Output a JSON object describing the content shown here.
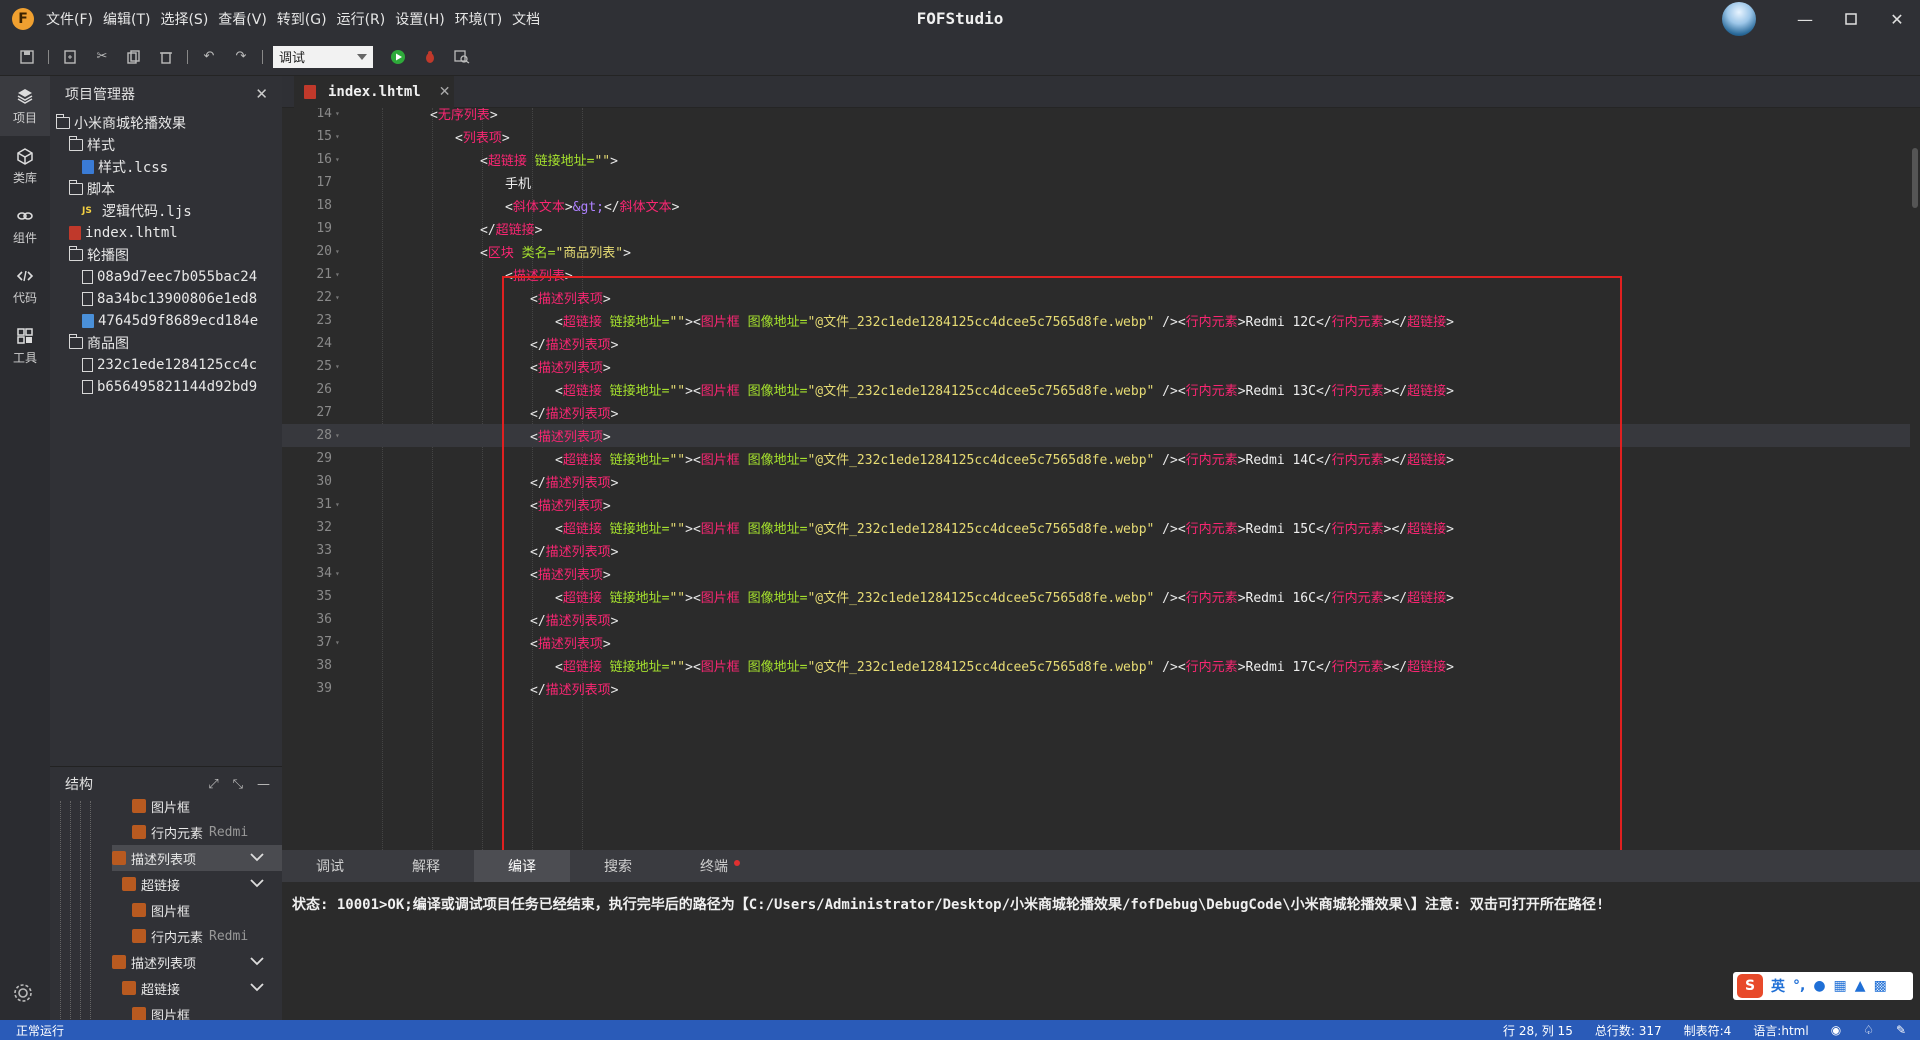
{
  "window": {
    "title": "FOFStudio",
    "menu": [
      "文件(F)",
      "编辑(T)",
      "选择(S)",
      "查看(V)",
      "转到(G)",
      "运行(R)",
      "设置(H)",
      "环境(T)",
      "文档"
    ]
  },
  "toolbar": {
    "mode_value": "调试"
  },
  "activity": {
    "items": [
      {
        "label": "项目",
        "icon": "layers-icon"
      },
      {
        "label": "类库",
        "icon": "cube-icon"
      },
      {
        "label": "组件",
        "icon": "link-icon"
      },
      {
        "label": "代码",
        "icon": "code-icon"
      },
      {
        "label": "工具",
        "icon": "tools-icon"
      }
    ]
  },
  "project": {
    "title": "项目管理器",
    "tree": [
      {
        "label": "小米商城轮播效果",
        "type": "folder",
        "depth": 0
      },
      {
        "label": "样式",
        "type": "folder",
        "depth": 1
      },
      {
        "label": "样式.lcss",
        "type": "css",
        "depth": 2
      },
      {
        "label": "脚本",
        "type": "folder",
        "depth": 1
      },
      {
        "label": "逻辑代码.ljs",
        "type": "js",
        "depth": 2
      },
      {
        "label": "index.lhtml",
        "type": "html",
        "depth": 1
      },
      {
        "label": "轮播图",
        "type": "folder",
        "depth": 1
      },
      {
        "label": "08a9d7eec7b055bac24",
        "type": "file",
        "depth": 2
      },
      {
        "label": "8a34bc13900806e1ed8",
        "type": "file",
        "depth": 2
      },
      {
        "label": "47645d9f8689ecd184e",
        "type": "img",
        "depth": 2
      },
      {
        "label": "商品图",
        "type": "folder",
        "depth": 1
      },
      {
        "label": "232c1ede1284125cc4c",
        "type": "file",
        "depth": 2
      },
      {
        "label": "b656495821144d92bd9",
        "type": "file",
        "depth": 2
      }
    ]
  },
  "structure": {
    "title": "结构",
    "rows": [
      {
        "label": "图片框",
        "extra": "",
        "indent": 2,
        "sel": false,
        "chev": false
      },
      {
        "label": "行内元素",
        "extra": "Redmi",
        "indent": 2,
        "sel": false,
        "chev": false
      },
      {
        "label": "描述列表项",
        "extra": "",
        "indent": 0,
        "sel": true,
        "chev": true
      },
      {
        "label": "超链接",
        "extra": "",
        "indent": 1,
        "sel": false,
        "chev": true
      },
      {
        "label": "图片框",
        "extra": "",
        "indent": 2,
        "sel": false,
        "chev": false
      },
      {
        "label": "行内元素",
        "extra": "Redmi",
        "indent": 2,
        "sel": false,
        "chev": false
      },
      {
        "label": "描述列表项",
        "extra": "",
        "indent": 0,
        "sel": false,
        "chev": true
      },
      {
        "label": "超链接",
        "extra": "",
        "indent": 1,
        "sel": false,
        "chev": true
      },
      {
        "label": "图片框",
        "extra": "",
        "indent": 2,
        "sel": false,
        "chev": false
      }
    ]
  },
  "editor": {
    "tab_label": "index.lhtml",
    "current_line": 28,
    "lines": [
      {
        "n": 14,
        "fold": true,
        "indent": 4,
        "tokens": [
          [
            "br",
            "<"
          ],
          [
            "tag",
            "无序列表"
          ],
          [
            "br",
            ">"
          ]
        ]
      },
      {
        "n": 15,
        "fold": true,
        "indent": 5,
        "tokens": [
          [
            "br",
            "<"
          ],
          [
            "tag",
            "列表项"
          ],
          [
            "br",
            ">"
          ]
        ]
      },
      {
        "n": 16,
        "fold": true,
        "indent": 6,
        "tokens": [
          [
            "br",
            "<"
          ],
          [
            "tag",
            "超链接 "
          ],
          [
            "attr",
            "链接地址="
          ],
          [
            "str",
            "\"\""
          ],
          [
            "br",
            ">"
          ]
        ]
      },
      {
        "n": 17,
        "fold": false,
        "indent": 7,
        "tokens": [
          [
            "txt",
            "手机"
          ]
        ]
      },
      {
        "n": 18,
        "fold": false,
        "indent": 7,
        "tokens": [
          [
            "br",
            "<"
          ],
          [
            "tag",
            "斜体文本"
          ],
          [
            "br",
            ">"
          ],
          [
            "ent",
            "&gt;"
          ],
          [
            "br",
            "</"
          ],
          [
            "tag",
            "斜体文本"
          ],
          [
            "br",
            ">"
          ]
        ]
      },
      {
        "n": 19,
        "fold": false,
        "indent": 6,
        "tokens": [
          [
            "br",
            "</"
          ],
          [
            "tag",
            "超链接"
          ],
          [
            "br",
            ">"
          ]
        ]
      },
      {
        "n": 20,
        "fold": true,
        "indent": 6,
        "tokens": [
          [
            "br",
            "<"
          ],
          [
            "tag",
            "区块 "
          ],
          [
            "attr",
            "类名="
          ],
          [
            "str",
            "\"商品列表\""
          ],
          [
            "br",
            ">"
          ]
        ]
      },
      {
        "n": 21,
        "fold": true,
        "indent": 7,
        "tokens": [
          [
            "br",
            "<"
          ],
          [
            "tag",
            "描述列表"
          ],
          [
            "br",
            ">"
          ]
        ]
      },
      {
        "n": 22,
        "fold": true,
        "indent": 8,
        "tokens": [
          [
            "br",
            "<"
          ],
          [
            "tag",
            "描述列表项"
          ],
          [
            "br",
            ">"
          ]
        ]
      },
      {
        "n": 23,
        "fold": false,
        "indent": 9,
        "tokens": [
          [
            "br",
            "<"
          ],
          [
            "tag",
            "超链接 "
          ],
          [
            "attr",
            "链接地址="
          ],
          [
            "str",
            "\"\""
          ],
          [
            "br",
            ">"
          ],
          [
            "br",
            "<"
          ],
          [
            "tag",
            "图片框 "
          ],
          [
            "attr",
            "图像地址="
          ],
          [
            "str",
            "\"@文件_232c1ede1284125cc4dcee5c7565d8fe.webp\""
          ],
          [
            "br",
            " />"
          ],
          [
            "br",
            "<"
          ],
          [
            "tag",
            "行内元素"
          ],
          [
            "br",
            ">"
          ],
          [
            "txt",
            "Redmi 12C"
          ],
          [
            "br",
            "</"
          ],
          [
            "tag",
            "行内元素"
          ],
          [
            "br",
            "></"
          ],
          [
            "tag",
            "超链接"
          ],
          [
            "br",
            ">"
          ]
        ]
      },
      {
        "n": 24,
        "fold": false,
        "indent": 8,
        "tokens": [
          [
            "br",
            "</"
          ],
          [
            "tag",
            "描述列表项"
          ],
          [
            "br",
            ">"
          ]
        ]
      },
      {
        "n": 25,
        "fold": true,
        "indent": 8,
        "tokens": [
          [
            "br",
            "<"
          ],
          [
            "tag",
            "描述列表项"
          ],
          [
            "br",
            ">"
          ]
        ]
      },
      {
        "n": 26,
        "fold": false,
        "indent": 9,
        "tokens": [
          [
            "br",
            "<"
          ],
          [
            "tag",
            "超链接 "
          ],
          [
            "attr",
            "链接地址="
          ],
          [
            "str",
            "\"\""
          ],
          [
            "br",
            ">"
          ],
          [
            "br",
            "<"
          ],
          [
            "tag",
            "图片框 "
          ],
          [
            "attr",
            "图像地址="
          ],
          [
            "str",
            "\"@文件_232c1ede1284125cc4dcee5c7565d8fe.webp\""
          ],
          [
            "br",
            " />"
          ],
          [
            "br",
            "<"
          ],
          [
            "tag",
            "行内元素"
          ],
          [
            "br",
            ">"
          ],
          [
            "txt",
            "Redmi 13C"
          ],
          [
            "br",
            "</"
          ],
          [
            "tag",
            "行内元素"
          ],
          [
            "br",
            "></"
          ],
          [
            "tag",
            "超链接"
          ],
          [
            "br",
            ">"
          ]
        ]
      },
      {
        "n": 27,
        "fold": false,
        "indent": 8,
        "tokens": [
          [
            "br",
            "</"
          ],
          [
            "tag",
            "描述列表项"
          ],
          [
            "br",
            ">"
          ]
        ]
      },
      {
        "n": 28,
        "fold": true,
        "indent": 8,
        "tokens": [
          [
            "br",
            "<"
          ],
          [
            "tag",
            "描述列表项"
          ],
          [
            "br",
            ">"
          ]
        ]
      },
      {
        "n": 29,
        "fold": false,
        "indent": 9,
        "tokens": [
          [
            "br",
            "<"
          ],
          [
            "tag",
            "超链接 "
          ],
          [
            "attr",
            "链接地址="
          ],
          [
            "str",
            "\"\""
          ],
          [
            "br",
            ">"
          ],
          [
            "br",
            "<"
          ],
          [
            "tag",
            "图片框 "
          ],
          [
            "attr",
            "图像地址="
          ],
          [
            "str",
            "\"@文件_232c1ede1284125cc4dcee5c7565d8fe.webp\""
          ],
          [
            "br",
            " />"
          ],
          [
            "br",
            "<"
          ],
          [
            "tag",
            "行内元素"
          ],
          [
            "br",
            ">"
          ],
          [
            "txt",
            "Redmi 14C"
          ],
          [
            "br",
            "</"
          ],
          [
            "tag",
            "行内元素"
          ],
          [
            "br",
            "></"
          ],
          [
            "tag",
            "超链接"
          ],
          [
            "br",
            ">"
          ]
        ]
      },
      {
        "n": 30,
        "fold": false,
        "indent": 8,
        "tokens": [
          [
            "br",
            "</"
          ],
          [
            "tag",
            "描述列表项"
          ],
          [
            "br",
            ">"
          ]
        ]
      },
      {
        "n": 31,
        "fold": true,
        "indent": 8,
        "tokens": [
          [
            "br",
            "<"
          ],
          [
            "tag",
            "描述列表项"
          ],
          [
            "br",
            ">"
          ]
        ]
      },
      {
        "n": 32,
        "fold": false,
        "indent": 9,
        "tokens": [
          [
            "br",
            "<"
          ],
          [
            "tag",
            "超链接 "
          ],
          [
            "attr",
            "链接地址="
          ],
          [
            "str",
            "\"\""
          ],
          [
            "br",
            ">"
          ],
          [
            "br",
            "<"
          ],
          [
            "tag",
            "图片框 "
          ],
          [
            "attr",
            "图像地址="
          ],
          [
            "str",
            "\"@文件_232c1ede1284125cc4dcee5c7565d8fe.webp\""
          ],
          [
            "br",
            " />"
          ],
          [
            "br",
            "<"
          ],
          [
            "tag",
            "行内元素"
          ],
          [
            "br",
            ">"
          ],
          [
            "txt",
            "Redmi 15C"
          ],
          [
            "br",
            "</"
          ],
          [
            "tag",
            "行内元素"
          ],
          [
            "br",
            "></"
          ],
          [
            "tag",
            "超链接"
          ],
          [
            "br",
            ">"
          ]
        ]
      },
      {
        "n": 33,
        "fold": false,
        "indent": 8,
        "tokens": [
          [
            "br",
            "</"
          ],
          [
            "tag",
            "描述列表项"
          ],
          [
            "br",
            ">"
          ]
        ]
      },
      {
        "n": 34,
        "fold": true,
        "indent": 8,
        "tokens": [
          [
            "br",
            "<"
          ],
          [
            "tag",
            "描述列表项"
          ],
          [
            "br",
            ">"
          ]
        ]
      },
      {
        "n": 35,
        "fold": false,
        "indent": 9,
        "tokens": [
          [
            "br",
            "<"
          ],
          [
            "tag",
            "超链接 "
          ],
          [
            "attr",
            "链接地址="
          ],
          [
            "str",
            "\"\""
          ],
          [
            "br",
            ">"
          ],
          [
            "br",
            "<"
          ],
          [
            "tag",
            "图片框 "
          ],
          [
            "attr",
            "图像地址="
          ],
          [
            "str",
            "\"@文件_232c1ede1284125cc4dcee5c7565d8fe.webp\""
          ],
          [
            "br",
            " />"
          ],
          [
            "br",
            "<"
          ],
          [
            "tag",
            "行内元素"
          ],
          [
            "br",
            ">"
          ],
          [
            "txt",
            "Redmi 16C"
          ],
          [
            "br",
            "</"
          ],
          [
            "tag",
            "行内元素"
          ],
          [
            "br",
            "></"
          ],
          [
            "tag",
            "超链接"
          ],
          [
            "br",
            ">"
          ]
        ]
      },
      {
        "n": 36,
        "fold": false,
        "indent": 8,
        "tokens": [
          [
            "br",
            "</"
          ],
          [
            "tag",
            "描述列表项"
          ],
          [
            "br",
            ">"
          ]
        ]
      },
      {
        "n": 37,
        "fold": true,
        "indent": 8,
        "tokens": [
          [
            "br",
            "<"
          ],
          [
            "tag",
            "描述列表项"
          ],
          [
            "br",
            ">"
          ]
        ]
      },
      {
        "n": 38,
        "fold": false,
        "indent": 9,
        "tokens": [
          [
            "br",
            "<"
          ],
          [
            "tag",
            "超链接 "
          ],
          [
            "attr",
            "链接地址="
          ],
          [
            "str",
            "\"\""
          ],
          [
            "br",
            ">"
          ],
          [
            "br",
            "<"
          ],
          [
            "tag",
            "图片框 "
          ],
          [
            "attr",
            "图像地址="
          ],
          [
            "str",
            "\"@文件_232c1ede1284125cc4dcee5c7565d8fe.webp\""
          ],
          [
            "br",
            " />"
          ],
          [
            "br",
            "<"
          ],
          [
            "tag",
            "行内元素"
          ],
          [
            "br",
            ">"
          ],
          [
            "txt",
            "Redmi 17C"
          ],
          [
            "br",
            "</"
          ],
          [
            "tag",
            "行内元素"
          ],
          [
            "br",
            "></"
          ],
          [
            "tag",
            "超链接"
          ],
          [
            "br",
            ">"
          ]
        ]
      },
      {
        "n": 39,
        "fold": false,
        "indent": 8,
        "tokens": [
          [
            "br",
            "</"
          ],
          [
            "tag",
            "描述列表项"
          ],
          [
            "br",
            ">"
          ]
        ]
      }
    ]
  },
  "bottom": {
    "tabs": [
      "调试",
      "解释",
      "编译",
      "搜索",
      "终端"
    ],
    "active_tab": 2,
    "output": "状态: 10001>OK;编译或调试项目任务已经结束，执行完毕后的路径为【C:/Users/Administrator/Desktop/小米商城轮播效果/fofDebug\\DebugCode\\小米商城轮播效果\\】注意: 双击可打开所在路径!"
  },
  "ime": {
    "logo": "S",
    "mode": "英"
  },
  "status": {
    "left": "正常运行",
    "position": "行 28, 列 15",
    "total_lines": "总行数: 317",
    "tab_size": "制表符:4",
    "language": "语言:html"
  },
  "colors": {
    "status_bar": "#2a5bb8",
    "highlight": "#e02020",
    "tag": "#f92672",
    "attr": "#a6e22e",
    "string": "#e6db74"
  }
}
